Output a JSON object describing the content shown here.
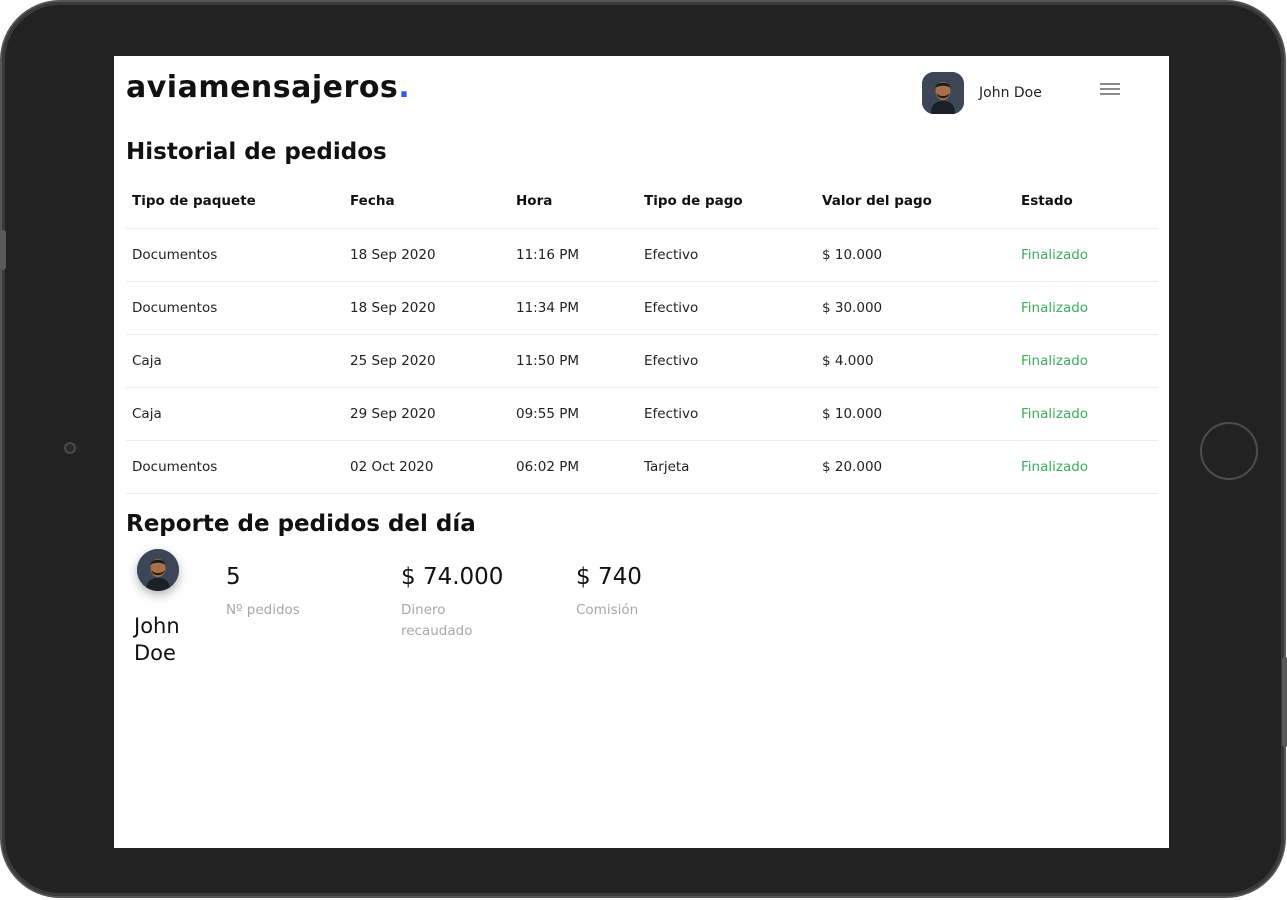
{
  "header": {
    "logo_text": "aviamensajeros",
    "logo_dot": ".",
    "user_name": "John Doe",
    "menu_icon": "hamburger-menu-icon"
  },
  "history": {
    "title": "Historial de pedidos",
    "columns": [
      "Tipo de paquete",
      "Fecha",
      "Hora",
      "Tipo de pago",
      "Valor del pago",
      "Estado"
    ],
    "rows": [
      [
        "Documentos",
        "18 Sep 2020",
        "11:16 PM",
        "Efectivo",
        "$ 10.000",
        "Finalizado"
      ],
      [
        "Documentos",
        "18 Sep 2020",
        "11:34 PM",
        "Efectivo",
        "$ 30.000",
        "Finalizado"
      ],
      [
        "Caja",
        "25 Sep 2020",
        "11:50 PM",
        "Efectivo",
        "$ 4.000",
        "Finalizado"
      ],
      [
        "Caja",
        "29 Sep 2020",
        "09:55 PM",
        "Efectivo",
        "$ 10.000",
        "Finalizado"
      ],
      [
        "Documentos",
        "02 Oct 2020",
        "06:02 PM",
        "Tarjeta",
        "$ 20.000",
        "Finalizado"
      ]
    ]
  },
  "report": {
    "title": "Reporte de pedidos del día",
    "user_name": "John Doe",
    "stats": [
      {
        "value": "5",
        "label": "Nº pedidos"
      },
      {
        "value": "$ 74.000",
        "label": "Dinero recaudado"
      },
      {
        "value": "$ 740",
        "label": "Comisión"
      }
    ]
  },
  "colors": {
    "accent": "#2f5bea",
    "status_finalizado": "#3cae5c",
    "muted_label": "#a8a8a8",
    "bezel": "#222222"
  }
}
